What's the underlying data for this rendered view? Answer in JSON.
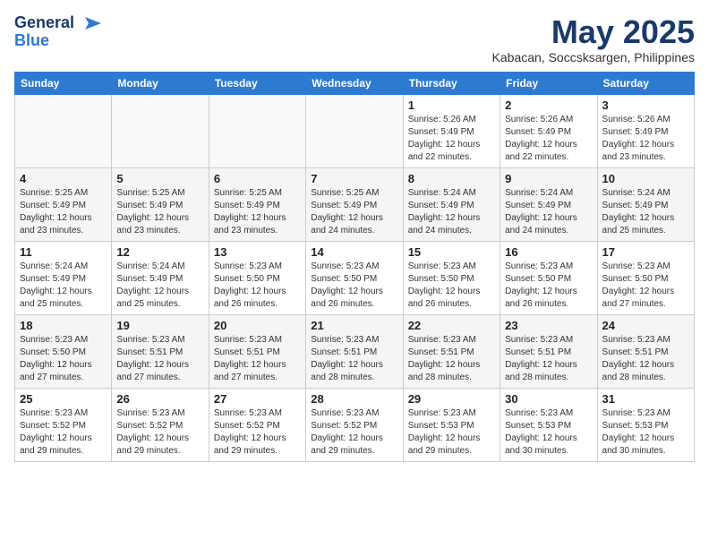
{
  "logo": {
    "general": "General",
    "blue": "Blue"
  },
  "title": "May 2025",
  "subtitle": "Kabacan, Soccsksargen, Philippines",
  "days_of_week": [
    "Sunday",
    "Monday",
    "Tuesday",
    "Wednesday",
    "Thursday",
    "Friday",
    "Saturday"
  ],
  "weeks": [
    [
      {
        "day": "",
        "sunrise": "",
        "sunset": "",
        "daylight": ""
      },
      {
        "day": "",
        "sunrise": "",
        "sunset": "",
        "daylight": ""
      },
      {
        "day": "",
        "sunrise": "",
        "sunset": "",
        "daylight": ""
      },
      {
        "day": "",
        "sunrise": "",
        "sunset": "",
        "daylight": ""
      },
      {
        "day": "1",
        "sunrise": "Sunrise: 5:26 AM",
        "sunset": "Sunset: 5:49 PM",
        "daylight": "Daylight: 12 hours and 22 minutes."
      },
      {
        "day": "2",
        "sunrise": "Sunrise: 5:26 AM",
        "sunset": "Sunset: 5:49 PM",
        "daylight": "Daylight: 12 hours and 22 minutes."
      },
      {
        "day": "3",
        "sunrise": "Sunrise: 5:26 AM",
        "sunset": "Sunset: 5:49 PM",
        "daylight": "Daylight: 12 hours and 23 minutes."
      }
    ],
    [
      {
        "day": "4",
        "sunrise": "Sunrise: 5:25 AM",
        "sunset": "Sunset: 5:49 PM",
        "daylight": "Daylight: 12 hours and 23 minutes."
      },
      {
        "day": "5",
        "sunrise": "Sunrise: 5:25 AM",
        "sunset": "Sunset: 5:49 PM",
        "daylight": "Daylight: 12 hours and 23 minutes."
      },
      {
        "day": "6",
        "sunrise": "Sunrise: 5:25 AM",
        "sunset": "Sunset: 5:49 PM",
        "daylight": "Daylight: 12 hours and 23 minutes."
      },
      {
        "day": "7",
        "sunrise": "Sunrise: 5:25 AM",
        "sunset": "Sunset: 5:49 PM",
        "daylight": "Daylight: 12 hours and 24 minutes."
      },
      {
        "day": "8",
        "sunrise": "Sunrise: 5:24 AM",
        "sunset": "Sunset: 5:49 PM",
        "daylight": "Daylight: 12 hours and 24 minutes."
      },
      {
        "day": "9",
        "sunrise": "Sunrise: 5:24 AM",
        "sunset": "Sunset: 5:49 PM",
        "daylight": "Daylight: 12 hours and 24 minutes."
      },
      {
        "day": "10",
        "sunrise": "Sunrise: 5:24 AM",
        "sunset": "Sunset: 5:49 PM",
        "daylight": "Daylight: 12 hours and 25 minutes."
      }
    ],
    [
      {
        "day": "11",
        "sunrise": "Sunrise: 5:24 AM",
        "sunset": "Sunset: 5:49 PM",
        "daylight": "Daylight: 12 hours and 25 minutes."
      },
      {
        "day": "12",
        "sunrise": "Sunrise: 5:24 AM",
        "sunset": "Sunset: 5:49 PM",
        "daylight": "Daylight: 12 hours and 25 minutes."
      },
      {
        "day": "13",
        "sunrise": "Sunrise: 5:23 AM",
        "sunset": "Sunset: 5:50 PM",
        "daylight": "Daylight: 12 hours and 26 minutes."
      },
      {
        "day": "14",
        "sunrise": "Sunrise: 5:23 AM",
        "sunset": "Sunset: 5:50 PM",
        "daylight": "Daylight: 12 hours and 26 minutes."
      },
      {
        "day": "15",
        "sunrise": "Sunrise: 5:23 AM",
        "sunset": "Sunset: 5:50 PM",
        "daylight": "Daylight: 12 hours and 26 minutes."
      },
      {
        "day": "16",
        "sunrise": "Sunrise: 5:23 AM",
        "sunset": "Sunset: 5:50 PM",
        "daylight": "Daylight: 12 hours and 26 minutes."
      },
      {
        "day": "17",
        "sunrise": "Sunrise: 5:23 AM",
        "sunset": "Sunset: 5:50 PM",
        "daylight": "Daylight: 12 hours and 27 minutes."
      }
    ],
    [
      {
        "day": "18",
        "sunrise": "Sunrise: 5:23 AM",
        "sunset": "Sunset: 5:50 PM",
        "daylight": "Daylight: 12 hours and 27 minutes."
      },
      {
        "day": "19",
        "sunrise": "Sunrise: 5:23 AM",
        "sunset": "Sunset: 5:51 PM",
        "daylight": "Daylight: 12 hours and 27 minutes."
      },
      {
        "day": "20",
        "sunrise": "Sunrise: 5:23 AM",
        "sunset": "Sunset: 5:51 PM",
        "daylight": "Daylight: 12 hours and 27 minutes."
      },
      {
        "day": "21",
        "sunrise": "Sunrise: 5:23 AM",
        "sunset": "Sunset: 5:51 PM",
        "daylight": "Daylight: 12 hours and 28 minutes."
      },
      {
        "day": "22",
        "sunrise": "Sunrise: 5:23 AM",
        "sunset": "Sunset: 5:51 PM",
        "daylight": "Daylight: 12 hours and 28 minutes."
      },
      {
        "day": "23",
        "sunrise": "Sunrise: 5:23 AM",
        "sunset": "Sunset: 5:51 PM",
        "daylight": "Daylight: 12 hours and 28 minutes."
      },
      {
        "day": "24",
        "sunrise": "Sunrise: 5:23 AM",
        "sunset": "Sunset: 5:51 PM",
        "daylight": "Daylight: 12 hours and 28 minutes."
      }
    ],
    [
      {
        "day": "25",
        "sunrise": "Sunrise: 5:23 AM",
        "sunset": "Sunset: 5:52 PM",
        "daylight": "Daylight: 12 hours and 29 minutes."
      },
      {
        "day": "26",
        "sunrise": "Sunrise: 5:23 AM",
        "sunset": "Sunset: 5:52 PM",
        "daylight": "Daylight: 12 hours and 29 minutes."
      },
      {
        "day": "27",
        "sunrise": "Sunrise: 5:23 AM",
        "sunset": "Sunset: 5:52 PM",
        "daylight": "Daylight: 12 hours and 29 minutes."
      },
      {
        "day": "28",
        "sunrise": "Sunrise: 5:23 AM",
        "sunset": "Sunset: 5:52 PM",
        "daylight": "Daylight: 12 hours and 29 minutes."
      },
      {
        "day": "29",
        "sunrise": "Sunrise: 5:23 AM",
        "sunset": "Sunset: 5:53 PM",
        "daylight": "Daylight: 12 hours and 29 minutes."
      },
      {
        "day": "30",
        "sunrise": "Sunrise: 5:23 AM",
        "sunset": "Sunset: 5:53 PM",
        "daylight": "Daylight: 12 hours and 30 minutes."
      },
      {
        "day": "31",
        "sunrise": "Sunrise: 5:23 AM",
        "sunset": "Sunset: 5:53 PM",
        "daylight": "Daylight: 12 hours and 30 minutes."
      }
    ]
  ]
}
